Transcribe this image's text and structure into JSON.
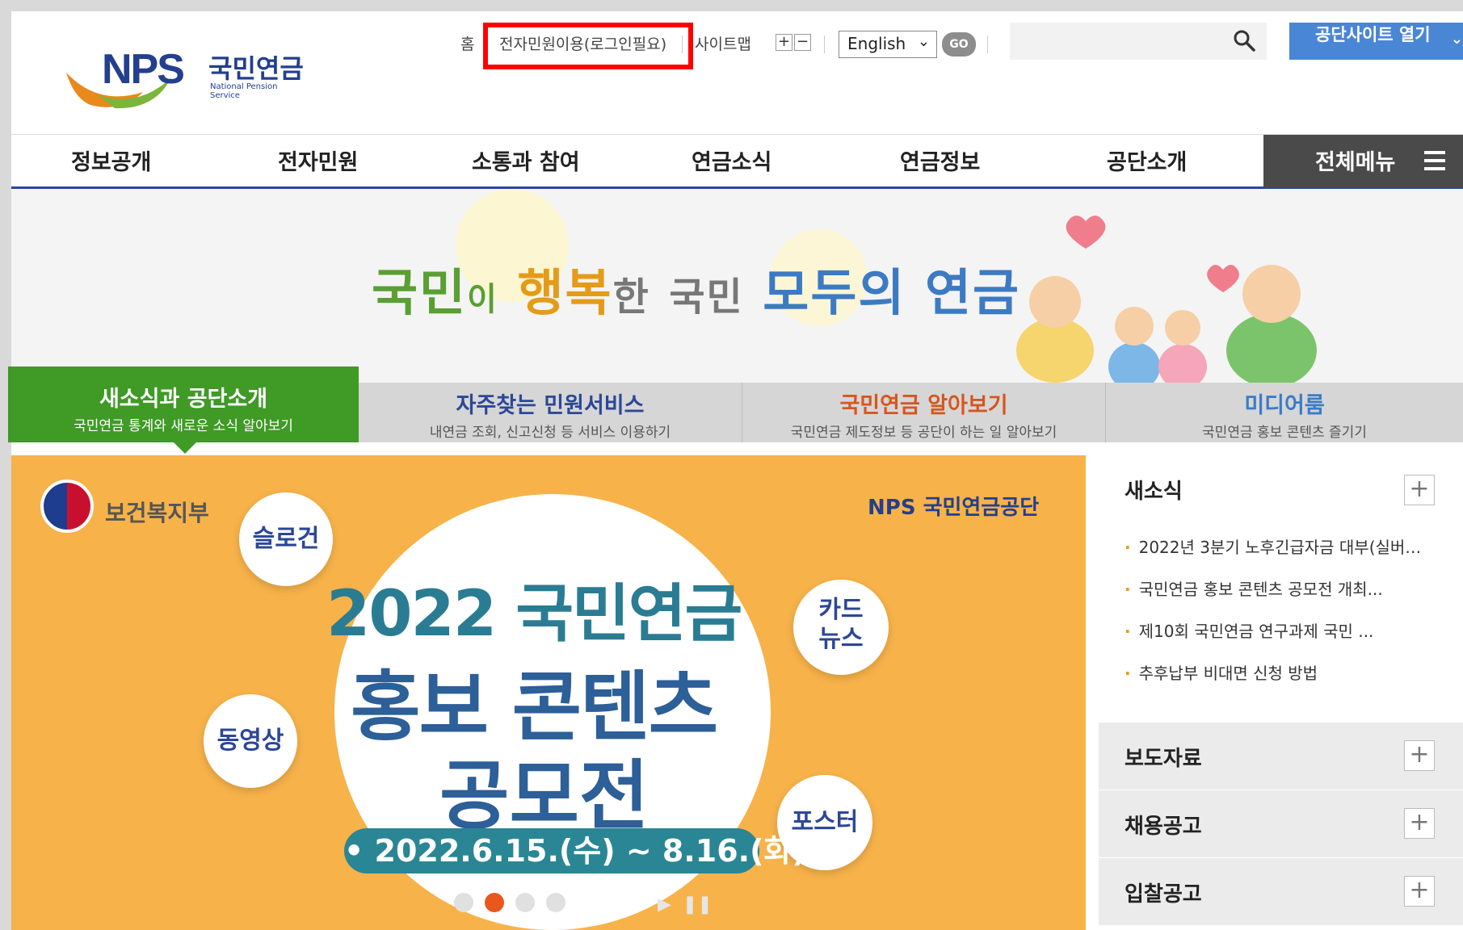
{
  "logo": {
    "brand": "NPS",
    "korean": "국민연금",
    "english": "National Pension Service"
  },
  "util": {
    "home": "홈",
    "eservice": "전자민원이용(로그인필요)",
    "sitemap": "사이트맵",
    "zoom_in": "+",
    "zoom_out": "−",
    "language": "English",
    "go": "GO",
    "search_placeholder": "",
    "family_site": "공단사이트 열기"
  },
  "gnb": {
    "items": [
      "정보공개",
      "전자민원",
      "소통과 참여",
      "연금소식",
      "연금정보",
      "공단소개"
    ],
    "all_menu": "전체메뉴"
  },
  "banner": {
    "slogan": [
      "국민",
      "이",
      "행복",
      "한",
      "국민",
      "모두의",
      "연금"
    ]
  },
  "tabs": [
    {
      "title": "새소식과 공단소개",
      "sub": "국민연금 통계와 새로운 소식 알아보기"
    },
    {
      "title": "자주찾는 민원서비스",
      "sub": "내연금 조회, 신고신청 등 서비스 이용하기"
    },
    {
      "title": "국민연금 알아보기",
      "sub": "국민연금 제도정보 등 공단이 하는 일 알아보기"
    },
    {
      "title": "미디어룸",
      "sub": "국민연금 홍보 콘텐츠 즐기기"
    }
  ],
  "promo": {
    "ministry": "보건복지부",
    "corp": "NPS 국민연금공단",
    "year": "2022 국민연금",
    "line2": "홍보 콘텐츠",
    "line3": "공모전",
    "date": "• 2022.6.15.(수) ~ 8.16.(화) •",
    "bubbles": [
      "슬로건",
      "카드뉴스",
      "동영상",
      "포스터"
    ],
    "bubble_card_1": "카드",
    "bubble_card_2": "뉴스"
  },
  "side": {
    "news_title": "새소식",
    "news": [
      "2022년 3분기 노후긴급자금 대부(실버…",
      "국민연금 홍보 콘텐츠 공모전 개최...",
      "제10회 국민연금 연구과제 국민 ...",
      "추후납부 비대면 신청 방법"
    ],
    "sections": [
      "보도자료",
      "채용공고",
      "입찰공고"
    ],
    "plus": "+"
  }
}
